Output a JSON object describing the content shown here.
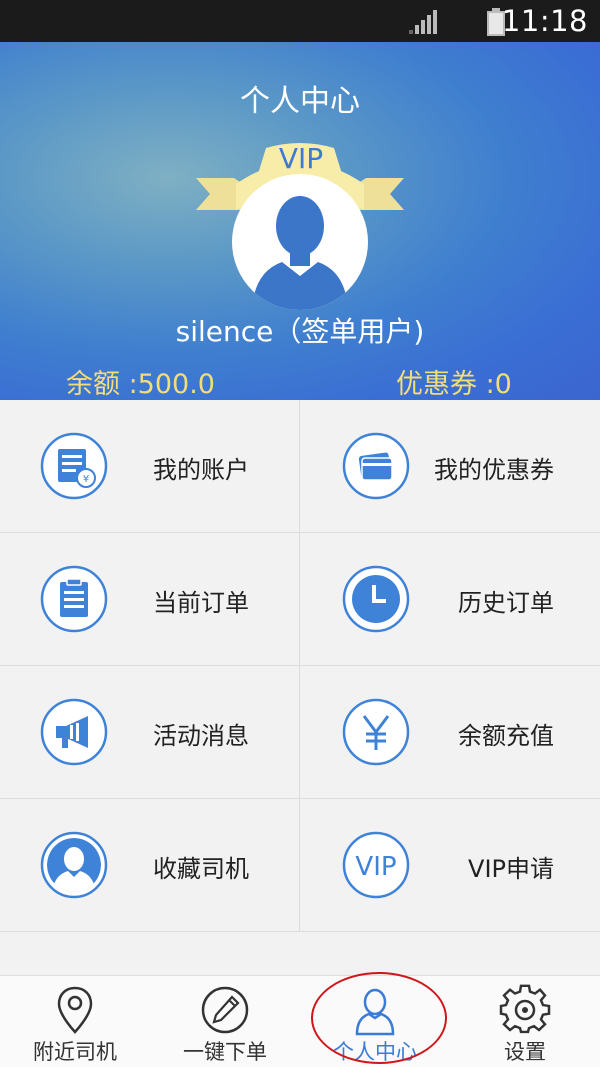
{
  "status_bar": {
    "time": "11:18",
    "signal_icon": "signal-icon",
    "battery_icon": "battery-icon"
  },
  "header": {
    "title": "个人中心",
    "vip_badge": "VIP",
    "username": "silence（签单用户)",
    "balance": "余额  :500.0",
    "coupons": "优惠券  :0"
  },
  "menu": {
    "items": [
      {
        "label": "我的账户",
        "icon": "account-bill-icon"
      },
      {
        "label": "我的优惠券",
        "icon": "coupon-card-icon"
      },
      {
        "label": "当前订单",
        "icon": "clipboard-icon"
      },
      {
        "label": "历史订单",
        "icon": "clock-icon"
      },
      {
        "label": "活动消息",
        "icon": "megaphone-icon"
      },
      {
        "label": "余额充值",
        "icon": "yen-icon"
      },
      {
        "label": "收藏司机",
        "icon": "driver-avatar-icon"
      },
      {
        "label": "VIP申请",
        "icon": "vip-icon"
      }
    ]
  },
  "tabbar": {
    "tabs": [
      {
        "label": "附近司机",
        "icon": "location-pin-icon"
      },
      {
        "label": "一键下单",
        "icon": "pencil-icon"
      },
      {
        "label": "个人中心",
        "icon": "person-icon",
        "active": true
      },
      {
        "label": "设置",
        "icon": "gear-icon"
      }
    ]
  },
  "colors": {
    "accent_blue": "#3a7bd5",
    "balance_yellow": "#f3dd77",
    "highlight_red": "#d0151b"
  }
}
